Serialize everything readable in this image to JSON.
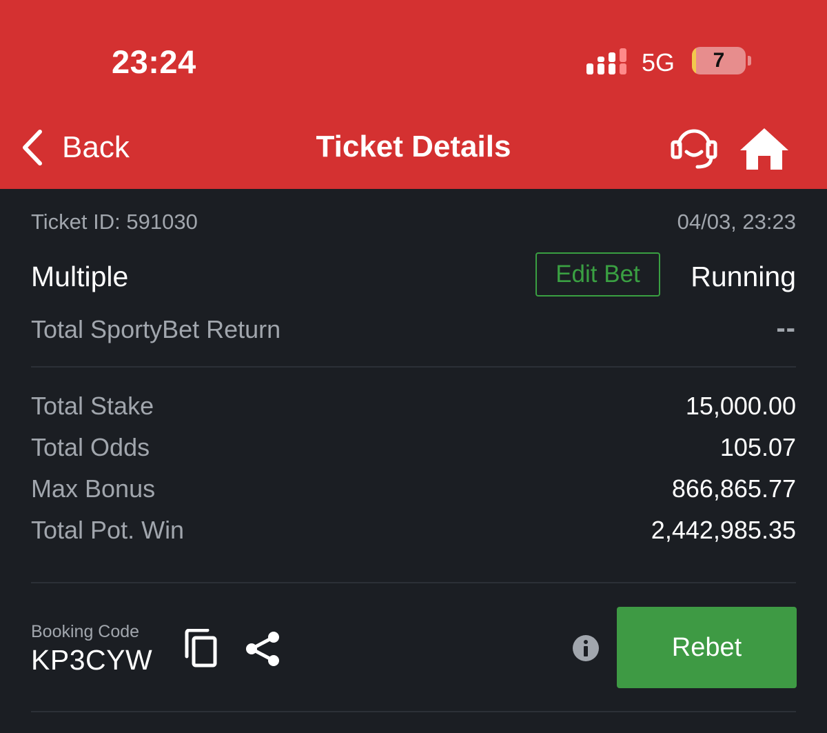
{
  "status_bar": {
    "time": "23:24",
    "network": "5G",
    "battery_level": "7",
    "battery_fraction": 0.07,
    "battery_color": "#f2c94c"
  },
  "nav": {
    "back_label": "Back",
    "title": "Ticket Details",
    "icons": [
      "chevron-left-icon",
      "customer-support-icon",
      "home-icon"
    ]
  },
  "ticket": {
    "id_text": "Ticket ID: 591030",
    "date_text": "04/03, 23:23",
    "bet_type": "Multiple",
    "edit_bet_label": "Edit Bet",
    "status": "Running",
    "return_label": "Total SportyBet Return",
    "return_value": "--"
  },
  "summary": {
    "rows": [
      {
        "label": "Total Stake",
        "value": "15,000.00"
      },
      {
        "label": "Total Odds",
        "value": "105.07"
      },
      {
        "label": "Max Bonus",
        "value": "866,865.77"
      },
      {
        "label": "Total Pot. Win",
        "value": "2,442,985.35"
      }
    ]
  },
  "booking": {
    "label": "Booking Code",
    "code": "KP3CYW",
    "icons": [
      "copy-icon",
      "share-icon",
      "info-icon"
    ],
    "rebet_label": "Rebet"
  },
  "colors": {
    "header_red": "#d43131",
    "background": "#1b1e23",
    "accent_green": "#3aa042",
    "rebet_green": "#3e9a44",
    "muted_text": "#a1a6ad"
  }
}
